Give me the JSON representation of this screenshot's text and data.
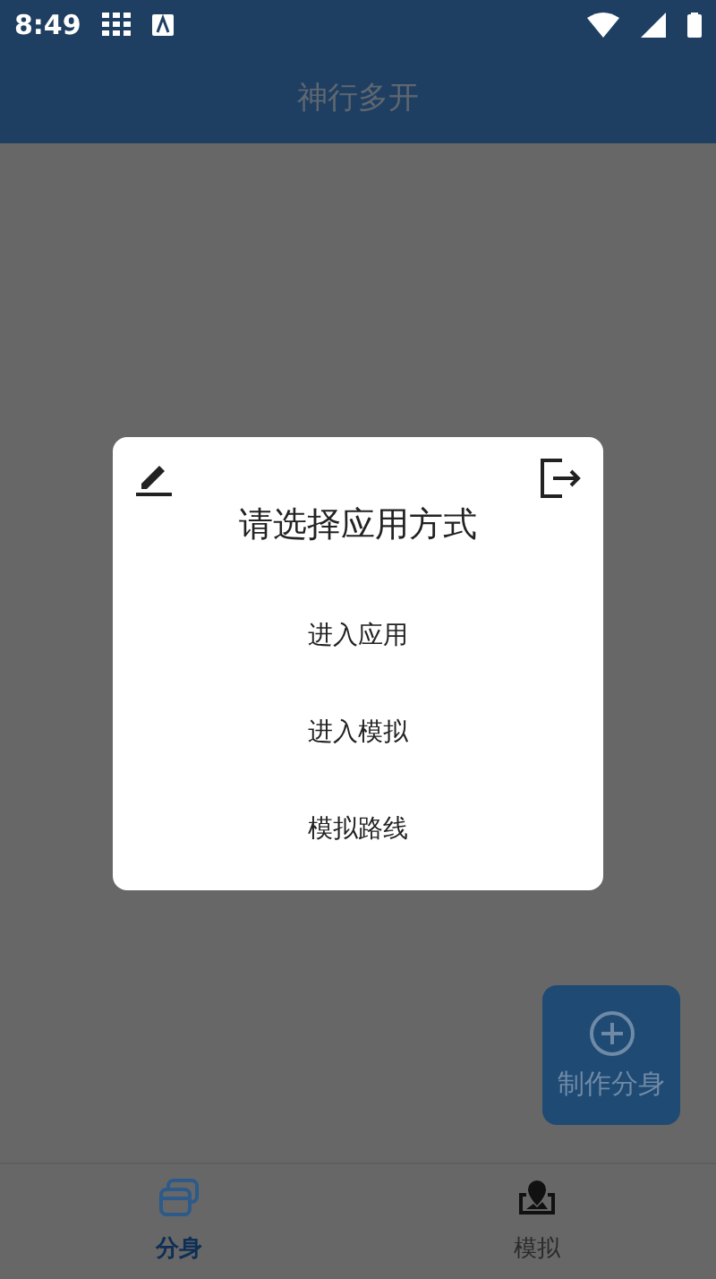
{
  "status_bar": {
    "time": "8:49"
  },
  "app_bar": {
    "title": "神行多开"
  },
  "dialog": {
    "title": "请选择应用方式",
    "options": [
      "进入应用",
      "进入模拟",
      "模拟路线"
    ]
  },
  "fab": {
    "label": "制作分身"
  },
  "bottom_nav": [
    {
      "label": "分身",
      "kind": "cards",
      "selected": true
    },
    {
      "label": "模拟",
      "kind": "map",
      "selected": false
    }
  ]
}
